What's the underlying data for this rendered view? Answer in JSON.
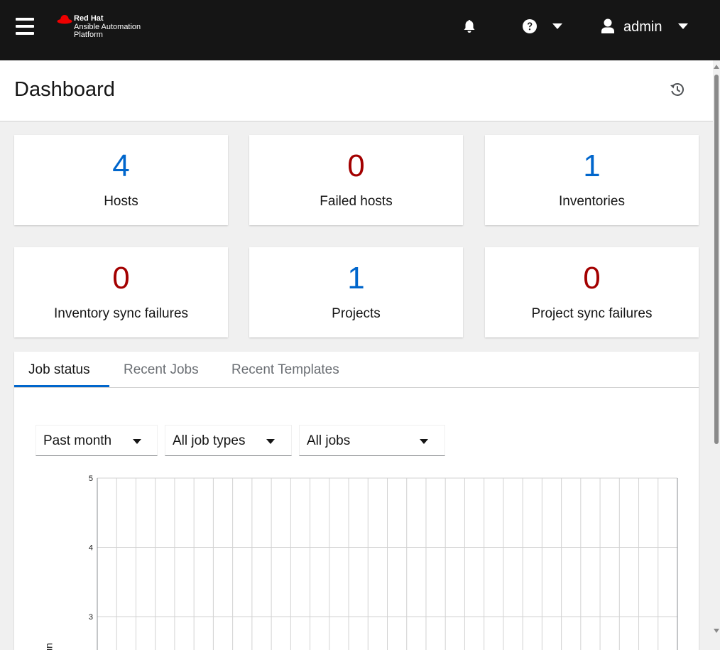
{
  "header": {
    "brand_line1": "Red Hat",
    "brand_line2": "Ansible Automation",
    "brand_line3": "Platform",
    "user": "admin",
    "icons": [
      "hamburger-icon",
      "bell-icon",
      "question-circle-icon",
      "user-icon",
      "caret-down-icon"
    ]
  },
  "page": {
    "title": "Dashboard"
  },
  "stats": [
    {
      "value": "4",
      "label": "Hosts",
      "color": "#0066cc"
    },
    {
      "value": "0",
      "label": "Failed hosts",
      "color": "#a30000"
    },
    {
      "value": "1",
      "label": "Inventories",
      "color": "#0066cc"
    },
    {
      "value": "0",
      "label": "Inventory sync failures",
      "color": "#a30000"
    },
    {
      "value": "1",
      "label": "Projects",
      "color": "#0066cc"
    },
    {
      "value": "0",
      "label": "Project sync failures",
      "color": "#a30000"
    }
  ],
  "tabs": [
    {
      "label": "Job status",
      "active": true
    },
    {
      "label": "Recent Jobs",
      "active": false
    },
    {
      "label": "Recent Templates",
      "active": false
    }
  ],
  "filters": {
    "period": "Past month",
    "job_type": "All job types",
    "jobs": "All jobs"
  },
  "chart_data": {
    "type": "line",
    "title": "",
    "ylabel": "Job Runs",
    "ylabel_visible_fragment": "uns",
    "y_ticks": [
      "5",
      "4",
      "3"
    ],
    "ylim": [
      0,
      5
    ],
    "x_gridlines": 31,
    "grid": true,
    "series": []
  }
}
